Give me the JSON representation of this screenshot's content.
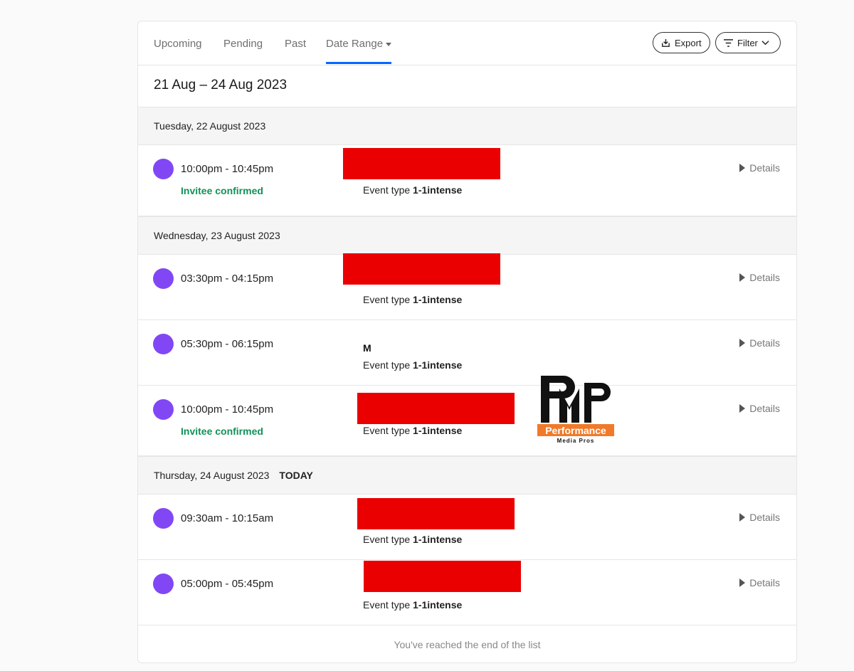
{
  "tabs": [
    {
      "label": "Upcoming"
    },
    {
      "label": "Pending"
    },
    {
      "label": "Past"
    },
    {
      "label": "Date Range"
    }
  ],
  "toolbar": {
    "export_label": "Export",
    "filter_label": "Filter"
  },
  "date_range": "21 Aug – 24 Aug 2023",
  "days": [
    {
      "label": "Tuesday, 22 August 2023"
    },
    {
      "label": "Wednesday, 23 August 2023"
    },
    {
      "label": "Thursday, 24 August 2023",
      "badge": "TODAY"
    }
  ],
  "events": [
    {
      "time": "10:00pm - 10:45pm",
      "status": "Invitee confirmed",
      "name": "",
      "event_type_label": "Event type",
      "event_type": "1-1intense",
      "details": "Details"
    },
    {
      "time": "03:30pm - 04:15pm",
      "status": "",
      "name": "",
      "event_type_label": "Event type",
      "event_type": "1-1intense",
      "details": "Details"
    },
    {
      "time": "05:30pm - 06:15pm",
      "status": "",
      "name": "M",
      "event_type_label": "Event type",
      "event_type": "1-1intense",
      "details": "Details"
    },
    {
      "time": "10:00pm - 10:45pm",
      "status": "Invitee confirmed",
      "name": "",
      "event_type_label": "Event type",
      "event_type": "1-1intense",
      "details": "Details"
    },
    {
      "time": "09:30am - 10:15am",
      "status": "",
      "name": "",
      "event_type_label": "Event type",
      "event_type": "1-1intense",
      "details": "Details"
    },
    {
      "time": "05:00pm - 05:45pm",
      "status": "",
      "name": "",
      "event_type_label": "Event type",
      "event_type": "1-1intense",
      "details": "Details"
    }
  ],
  "footer": "You've reached the end of the list",
  "watermark": {
    "letters": "PMP",
    "line1": "Performance",
    "line2": "Media Pros"
  },
  "colors": {
    "accent": "#0069ff",
    "avatar": "#8247f5",
    "confirmed": "#12915a",
    "redaction": "#ea0000",
    "logo_orange": "#f07a2a"
  }
}
